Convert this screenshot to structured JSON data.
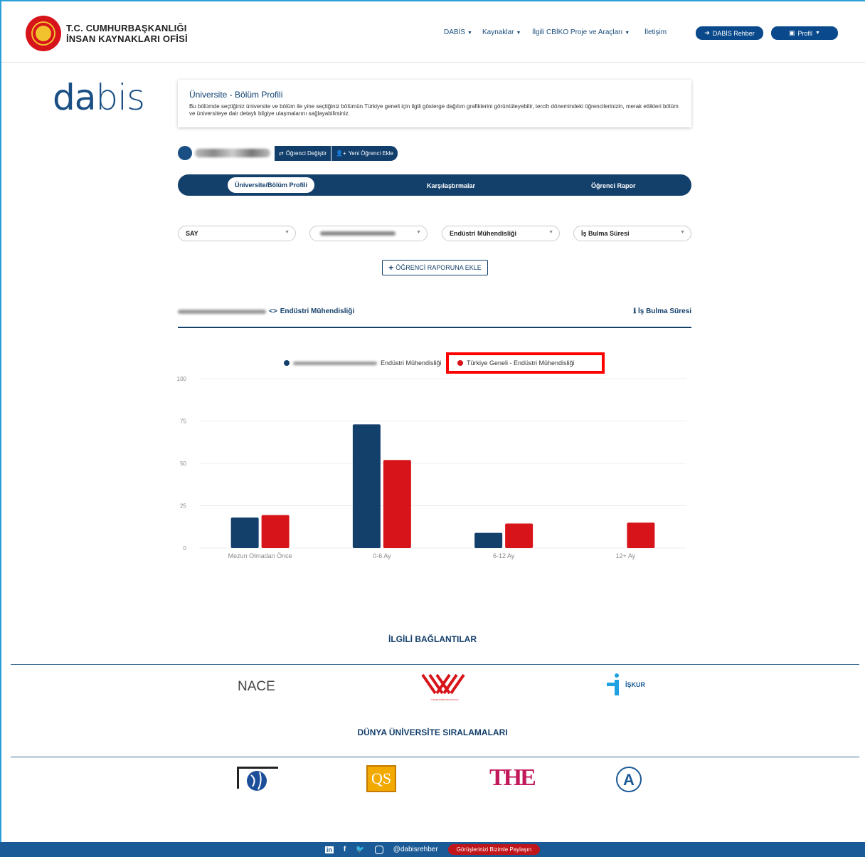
{
  "header": {
    "org_line1": "T.C. CUMHURBAŞKANLIĞI",
    "org_line2": "İNSAN KAYNAKLARI OFİSİ",
    "nav": [
      "DABİS",
      "Kaynaklar",
      "İlgili CBİKO Proje ve Araçları",
      "İletişim"
    ],
    "rehber_label": "DABİS Rehber",
    "profil_label": "Profil"
  },
  "brand": {
    "logo_bold": "da",
    "logo_thin": "bis"
  },
  "intro": {
    "title": "Üniversite - Bölüm Profili",
    "text": "Bu bölümde seçtiğiniz üniversite ve bölüm ile yine seçtiğiniz bölümün Türkiye geneli için ilgili gösterge dağılım grafiklerini görüntüleyebilir, tercih dönemindeki öğrencilerinizin, merak ettikleri bölüm ve üniversiteye dair detaylı bilgiye ulaşmalarını sağlayabilirsiniz."
  },
  "student": {
    "change_label": "Öğrenci Değiştir",
    "add_label": "Yeni Öğrenci Ekle"
  },
  "tabs": {
    "t1": "Üniversite/Bölüm Profili",
    "t2": "Karşılaştırmalar",
    "t3": "Öğrenci Rapor"
  },
  "filters": {
    "score_type": "SAY",
    "department": "Endüstri Mühendisliği",
    "indicator": "İş Bulma Süresi"
  },
  "add_report_label": "ÖĞRENCİ RAPORUNA EKLE",
  "chart_header": {
    "department": "Endüstri Mühendisliği",
    "indicator": "İş Bulma Süresi"
  },
  "colors": {
    "navy": "#133f6b",
    "red": "#d7141a"
  },
  "chart_data": {
    "type": "bar",
    "categories": [
      "Mezun Olmadan Önce",
      "0-6 Ay",
      "6-12 Ay",
      "12+ Ay"
    ],
    "series": [
      {
        "name": "Endüstri Mühendisliği",
        "values": [
          18,
          73,
          9,
          0
        ]
      },
      {
        "name": "Türkiye Geneli - Endüstri Mühendisliği",
        "values": [
          19.5,
          52,
          14.5,
          15
        ]
      }
    ],
    "yticks": [
      "0",
      "25",
      "50",
      "75",
      "100"
    ],
    "ylim": [
      0,
      100
    ],
    "grid": true,
    "legend": "top"
  },
  "links": {
    "related_title": "İLGİLİ BAĞLANTILAR",
    "nace": "NACE",
    "yok": "YÜKSEKÖĞRETİM KURULU",
    "iskur": "İŞKUR",
    "rankings_title": "DÜNYA ÜNİVERSİTE SIRALAMALARI",
    "qs": "QS",
    "the": "THE"
  },
  "footer": {
    "handle": "@dabisrehber",
    "feedback": "Görüşlerinizi Bizimle Paylaşın"
  }
}
